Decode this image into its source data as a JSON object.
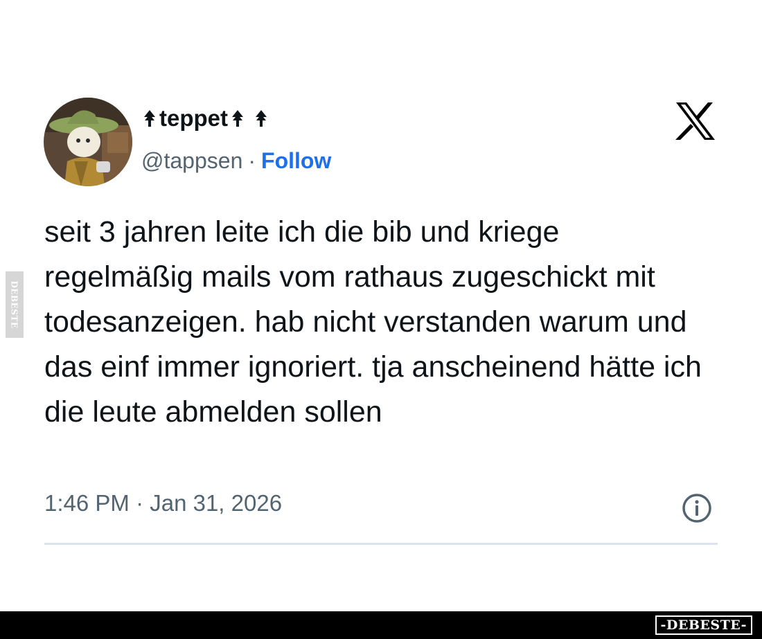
{
  "watermark": {
    "side_text": "DEBESTE",
    "bottom_text": "-DEBESTE-"
  },
  "tweet": {
    "avatar_icon": "avatar-illustration",
    "display_name": "teppet",
    "name_decoration_icon": "tree-arrow-icon",
    "handle": "@tappsen",
    "separator": "·",
    "follow_label": "Follow",
    "text": "seit 3 jahren leite ich die bib und kriege regelmäßig mails vom rathaus zugeschickt mit todesanzeigen. hab nicht verstanden warum und das einf immer ignoriert. tja anscheinend hätte ich die leute abmelden sollen",
    "timestamp": "1:46 PM · Jan 31, 2026",
    "platform_icon": "x-logo-icon",
    "info_icon": "info-icon"
  },
  "colors": {
    "text": "#0f1419",
    "secondary_text": "#536471",
    "follow_link": "#1d70e8",
    "divider": "#dde3ea"
  }
}
